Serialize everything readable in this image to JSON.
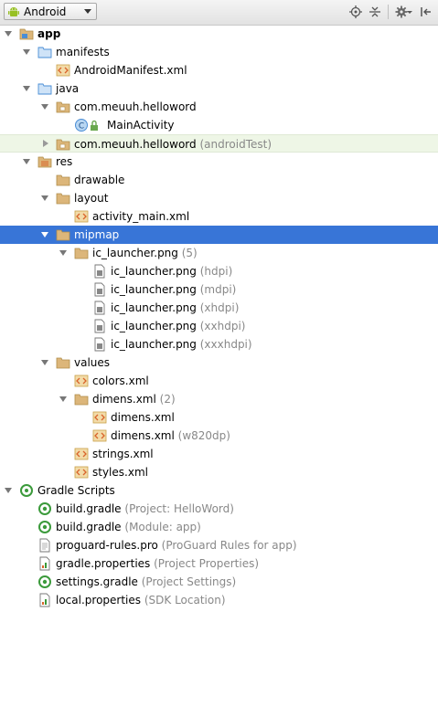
{
  "toolbar": {
    "view_mode": "Android",
    "icons": [
      "android-icon",
      "locate-icon",
      "collapse-all-icon",
      "gear-icon",
      "hide-panel-icon"
    ]
  },
  "tree": [
    {
      "label": "app",
      "bold": true
    },
    {
      "label": "manifests"
    },
    {
      "label": "AndroidManifest.xml"
    },
    {
      "label": "java"
    },
    {
      "label": "com.meuuh.helloword"
    },
    {
      "label": "MainActivity"
    },
    {
      "label": "com.meuuh.helloword",
      "hint": "(androidTest)"
    },
    {
      "label": "res"
    },
    {
      "label": "drawable"
    },
    {
      "label": "layout"
    },
    {
      "label": "activity_main.xml"
    },
    {
      "label": "mipmap"
    },
    {
      "label": "ic_launcher.png",
      "hint": "(5)"
    },
    {
      "label": "ic_launcher.png",
      "hint": "(hdpi)"
    },
    {
      "label": "ic_launcher.png",
      "hint": "(mdpi)"
    },
    {
      "label": "ic_launcher.png",
      "hint": "(xhdpi)"
    },
    {
      "label": "ic_launcher.png",
      "hint": "(xxhdpi)"
    },
    {
      "label": "ic_launcher.png",
      "hint": "(xxxhdpi)"
    },
    {
      "label": "values"
    },
    {
      "label": "colors.xml"
    },
    {
      "label": "dimens.xml",
      "hint": "(2)"
    },
    {
      "label": "dimens.xml"
    },
    {
      "label": "dimens.xml",
      "hint": "(w820dp)"
    },
    {
      "label": "strings.xml"
    },
    {
      "label": "styles.xml"
    },
    {
      "label": "Gradle Scripts"
    },
    {
      "label": "build.gradle",
      "hint": "(Project: HelloWord)"
    },
    {
      "label": "build.gradle",
      "hint": "(Module: app)"
    },
    {
      "label": "proguard-rules.pro",
      "hint": "(ProGuard Rules for app)"
    },
    {
      "label": "gradle.properties",
      "hint": "(Project Properties)"
    },
    {
      "label": "settings.gradle",
      "hint": "(Project Settings)"
    },
    {
      "label": "local.properties",
      "hint": "(SDK Location)"
    }
  ],
  "colors": {
    "selection": "#3875d7",
    "folder": "#dcb67a",
    "android_green": "#97c024",
    "gradle_green": "#3b9a3b"
  }
}
